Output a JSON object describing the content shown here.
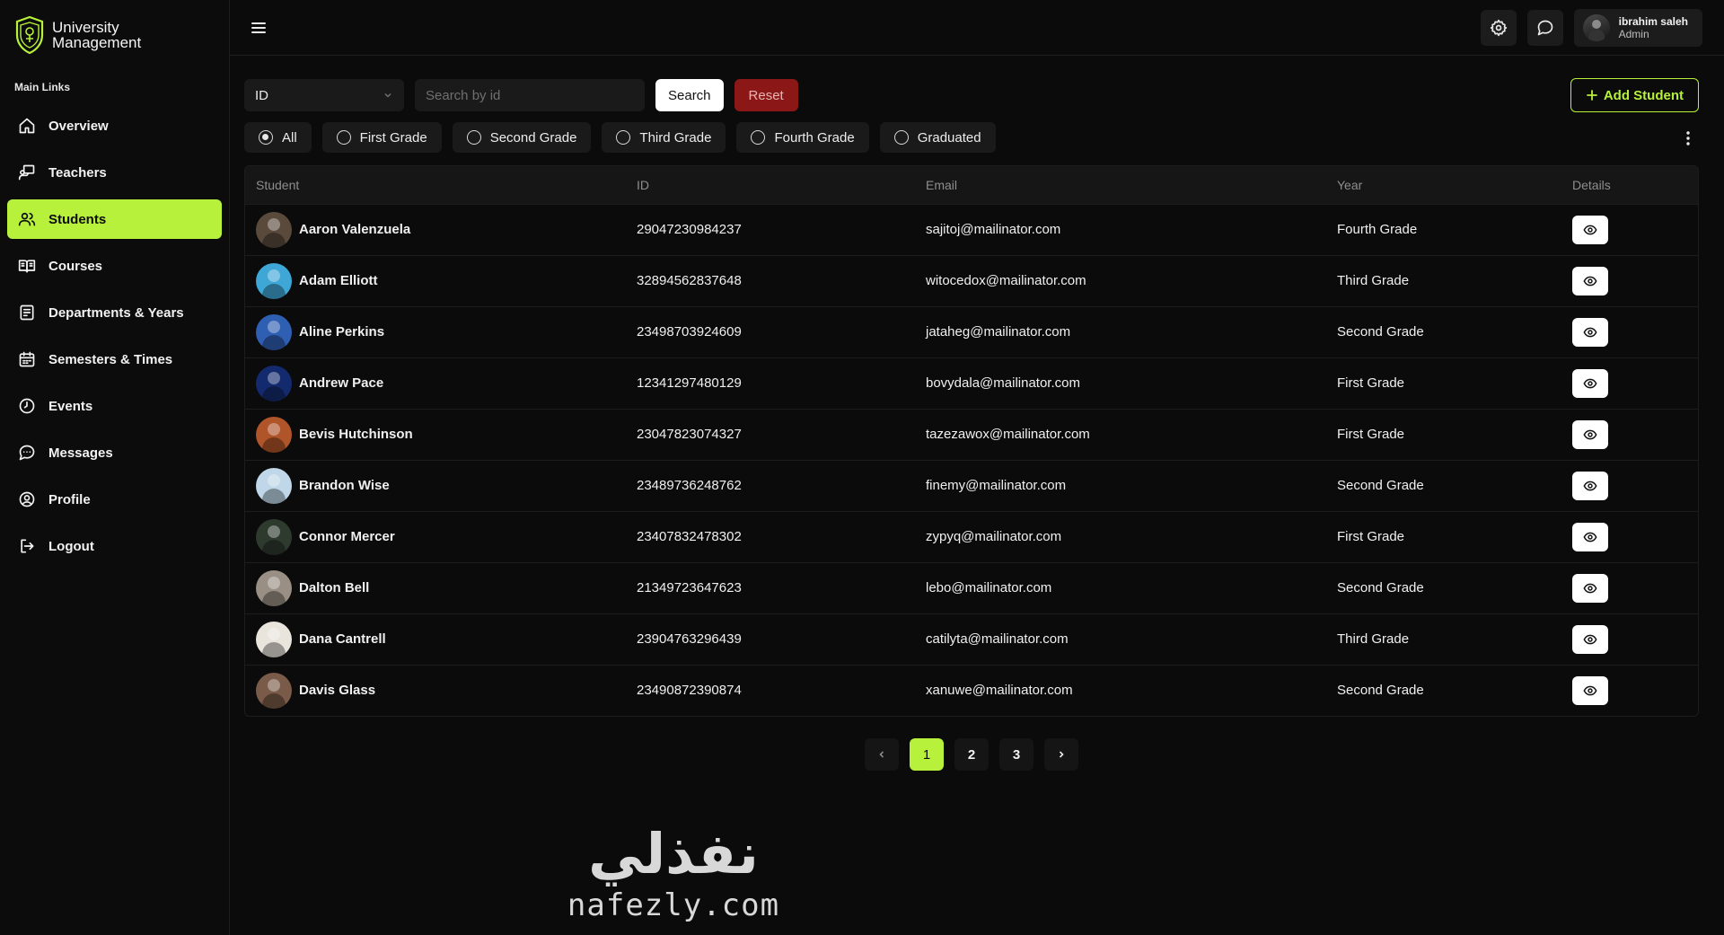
{
  "brand": {
    "line1": "University",
    "line2": "Management"
  },
  "sidebar": {
    "section_label": "Main Links",
    "items": [
      {
        "label": "Overview",
        "icon": "home-icon",
        "active": false
      },
      {
        "label": "Teachers",
        "icon": "teacher-board-icon",
        "active": false
      },
      {
        "label": "Students",
        "icon": "users-icon",
        "active": true
      },
      {
        "label": "Courses",
        "icon": "book-open-icon",
        "active": false
      },
      {
        "label": "Departments & Years",
        "icon": "clipboard-list-icon",
        "active": false
      },
      {
        "label": "Semesters & Times",
        "icon": "calendar-icon",
        "active": false
      },
      {
        "label": "Events",
        "icon": "clock-icon",
        "active": false
      },
      {
        "label": "Messages",
        "icon": "message-icon",
        "active": false
      },
      {
        "label": "Profile",
        "icon": "user-circle-icon",
        "active": false
      },
      {
        "label": "Logout",
        "icon": "logout-icon",
        "active": false
      }
    ]
  },
  "topbar": {
    "user_name": "ibrahim saleh",
    "user_role": "Admin"
  },
  "filters": {
    "select_value": "ID",
    "search_placeholder": "Search by id",
    "search_label": "Search",
    "reset_label": "Reset",
    "add_label": "Add Student",
    "grades": [
      {
        "label": "All",
        "checked": true
      },
      {
        "label": "First Grade",
        "checked": false
      },
      {
        "label": "Second Grade",
        "checked": false
      },
      {
        "label": "Third Grade",
        "checked": false
      },
      {
        "label": "Fourth Grade",
        "checked": false
      },
      {
        "label": "Graduated",
        "checked": false
      }
    ]
  },
  "table": {
    "columns": [
      "Student",
      "ID",
      "Email",
      "Year",
      "Details"
    ],
    "rows": [
      {
        "name": "Aaron Valenzuela",
        "id": "29047230984237",
        "email": "sajitoj@mailinator.com",
        "year": "Fourth Grade",
        "avatar_color": "#5a4a3c"
      },
      {
        "name": "Adam Elliott",
        "id": "32894562837648",
        "email": "witocedox@mailinator.com",
        "year": "Third Grade",
        "avatar_color": "#3fa7d6"
      },
      {
        "name": "Aline Perkins",
        "id": "23498703924609",
        "email": "jataheg@mailinator.com",
        "year": "Second Grade",
        "avatar_color": "#2f5fb3"
      },
      {
        "name": "Andrew Pace",
        "id": "12341297480129",
        "email": "bovydala@mailinator.com",
        "year": "First Grade",
        "avatar_color": "#142a6e"
      },
      {
        "name": "Bevis Hutchinson",
        "id": "23047823074327",
        "email": "tazezawox@mailinator.com",
        "year": "First Grade",
        "avatar_color": "#b0542a"
      },
      {
        "name": "Brandon Wise",
        "id": "23489736248762",
        "email": "finemy@mailinator.com",
        "year": "Second Grade",
        "avatar_color": "#bfd7e8"
      },
      {
        "name": "Connor Mercer",
        "id": "23407832478302",
        "email": "zypyq@mailinator.com",
        "year": "First Grade",
        "avatar_color": "#2e3a2e"
      },
      {
        "name": "Dalton Bell",
        "id": "21349723647623",
        "email": "lebo@mailinator.com",
        "year": "Second Grade",
        "avatar_color": "#9a8f84"
      },
      {
        "name": "Dana Cantrell",
        "id": "23904763296439",
        "email": "catilyta@mailinator.com",
        "year": "Third Grade",
        "avatar_color": "#e9e4dc"
      },
      {
        "name": "Davis Glass",
        "id": "23490872390874",
        "email": "xanuwe@mailinator.com",
        "year": "Second Grade",
        "avatar_color": "#7a5a48"
      }
    ]
  },
  "pagination": {
    "pages": [
      "1",
      "2",
      "3"
    ],
    "current": "1"
  },
  "watermark": {
    "arabic": "نفذلي",
    "latin": "nafezly.com"
  },
  "colors": {
    "accent": "#b7f13b",
    "reset": "#8c1717",
    "background": "#0b0b0b"
  }
}
